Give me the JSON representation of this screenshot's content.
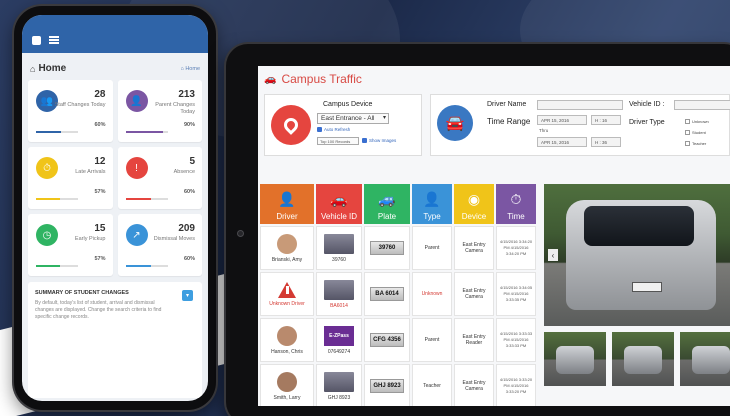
{
  "colors": {
    "blue": "#2f64a8",
    "red": "#e5453f",
    "orange": "#e2712a",
    "green": "#2fb463",
    "lightblue": "#3a93d8",
    "yellow": "#f0c419",
    "purple": "#7b56a3"
  },
  "phone": {
    "title": "Home",
    "breadcrumb": "Home",
    "cards": [
      {
        "value": "28",
        "label": "Staff Changes Today",
        "pct": "60%",
        "color": "#2f64a8",
        "icon": "users-icon",
        "fill": 0.6
      },
      {
        "value": "213",
        "label": "Parent Changes Today",
        "pct": "90%",
        "color": "#7b56a3",
        "icon": "person-icon",
        "fill": 0.9
      },
      {
        "value": "12",
        "label": "Late Arrivals",
        "pct": "57%",
        "color": "#f0c419",
        "icon": "clock-icon",
        "fill": 0.57
      },
      {
        "value": "5",
        "label": "Absence",
        "pct": "60%",
        "color": "#e5453f",
        "icon": "alert-icon",
        "fill": 0.6
      },
      {
        "value": "15",
        "label": "Early Pickup",
        "pct": "57%",
        "color": "#2fb463",
        "icon": "timer-icon",
        "fill": 0.57
      },
      {
        "value": "209",
        "label": "Dismissal Moves",
        "pct": "60%",
        "color": "#3a93d8",
        "icon": "share-icon",
        "fill": 0.6
      }
    ],
    "summary_title": "SUMMARY OF STUDENT CHANGES",
    "summary_text": "By default, today's list of student, arrival and dismissal changes are displayed. Change the search criteria to find specific change records."
  },
  "tablet": {
    "title": "Campus Traffic",
    "device_label": "Campus Device",
    "device_value": "East Entrance - All",
    "auto_refresh": "Auto Refresh",
    "records": "Top 100 Records",
    "show_images": "Show Images",
    "driver_name_label": "Driver Name",
    "vehicle_id_label": "Vehicle ID :",
    "time_range_label": "Time Range",
    "date_from": "APR 15, 2016",
    "time_from": "H : 16",
    "thru": "Thru",
    "date_to": "APR 15, 2016",
    "time_to": "H : 36",
    "driver_type_label": "Driver Type",
    "driver_type_options": [
      "Unknown",
      "Student",
      "Teacher"
    ],
    "columns": [
      {
        "label": "Driver",
        "color": "#e2712a",
        "icon": "person-icon"
      },
      {
        "label": "Vehicle ID",
        "color": "#e5453f",
        "icon": "car-icon"
      },
      {
        "label": "Plate",
        "color": "#2fb463",
        "icon": "cars-icon"
      },
      {
        "label": "Type",
        "color": "#3a93d8",
        "icon": "person-icon"
      },
      {
        "label": "Device",
        "color": "#f0c419",
        "icon": "broadcast-icon"
      },
      {
        "label": "Time",
        "color": "#7b56a3",
        "icon": "clock-icon"
      }
    ],
    "rows": [
      {
        "driver": "Brianski, Amy",
        "vehicle": "39760",
        "plate": "39760",
        "type": "Parent",
        "device": "East Entry Camera",
        "time": "4/15/2016 3:34:20 PM 4/15/2016 3:34:20 PM"
      },
      {
        "driver": "Unknown Driver",
        "vehicle": "BA6014",
        "plate": "BA 6014",
        "type": "Unknown",
        "device": "East Entry Camera",
        "time": "4/15/2016 3:34:05 PM 4/15/2016 3:33:35 PM"
      },
      {
        "driver": "Hanson, Chris",
        "vehicle": "07649274",
        "plate": "CFG 4356",
        "type": "Parent",
        "device": "East Entry Reader",
        "time": "4/15/2016 3:33:33 PM 4/15/2016 3:33:33 PM"
      },
      {
        "driver": "Smith, Larry",
        "vehicle": "GHJ 8923",
        "plate": "GHJ 8923",
        "type": "Teacher",
        "device": "East Entry Camera",
        "time": "4/15/2016 3:33:20 PM 4/15/2016 3:33:20 PM"
      }
    ],
    "ezpass": "E-ZPass"
  }
}
